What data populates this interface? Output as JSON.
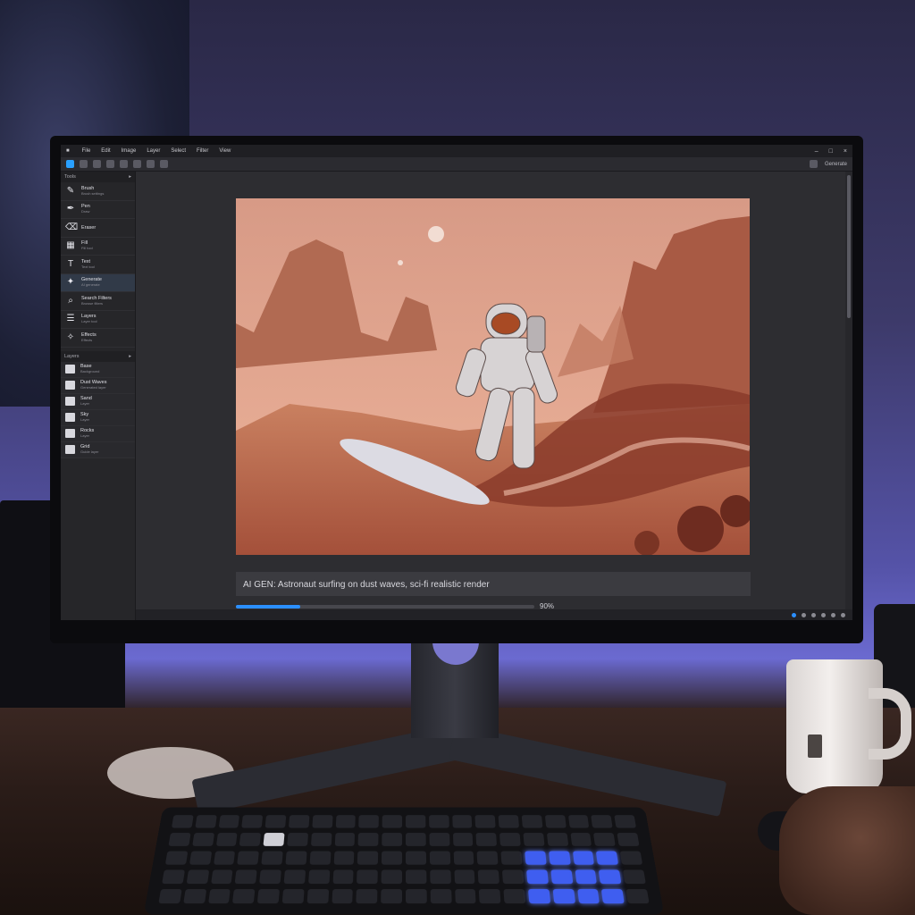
{
  "app": {
    "menu": [
      "File",
      "Edit",
      "Image",
      "Layer",
      "Select",
      "Filter",
      "View"
    ],
    "window_controls": [
      "–",
      "□",
      "×"
    ]
  },
  "toolbar": {
    "right_label": "Generate"
  },
  "tools_panel": {
    "title": "Tools",
    "items": [
      {
        "name": "Brush",
        "sub": "Brush settings",
        "icon": "brush-icon"
      },
      {
        "name": "Pen",
        "sub": "Draw",
        "icon": "pen-icon"
      },
      {
        "name": "Eraser",
        "sub": "",
        "icon": "eraser-icon"
      },
      {
        "name": "Fill",
        "sub": "Fill tool",
        "icon": "fill-icon"
      },
      {
        "name": "Text",
        "sub": "Text tool",
        "icon": "text-icon"
      },
      {
        "name": "Generate",
        "sub": "AI generate",
        "icon": "generate-icon"
      },
      {
        "name": "Search Filters",
        "sub": "Browse filters",
        "icon": "search-icon"
      },
      {
        "name": "Layers",
        "sub": "Layer tool",
        "icon": "layers-icon"
      },
      {
        "name": "Effects",
        "sub": "Effects",
        "icon": "effects-icon"
      }
    ]
  },
  "layers_panel": {
    "title": "Layers",
    "items": [
      {
        "name": "Base",
        "sub": "Background"
      },
      {
        "name": "Dust Waves",
        "sub": "Generated layer"
      },
      {
        "name": "Sand",
        "sub": "Layer"
      },
      {
        "name": "Sky",
        "sub": "Layer"
      },
      {
        "name": "Rocks",
        "sub": "Layer"
      },
      {
        "name": "Grid",
        "sub": "Guide layer"
      }
    ]
  },
  "prompt": {
    "text": "AI GEN: Astronaut surfing on dust waves, sci-fi realistic render"
  },
  "progress": {
    "value": 0.9,
    "label": "90%"
  },
  "colors": {
    "accent": "#2b8fff",
    "panel": "#262629",
    "canvas_bg": "#2d2d31"
  }
}
